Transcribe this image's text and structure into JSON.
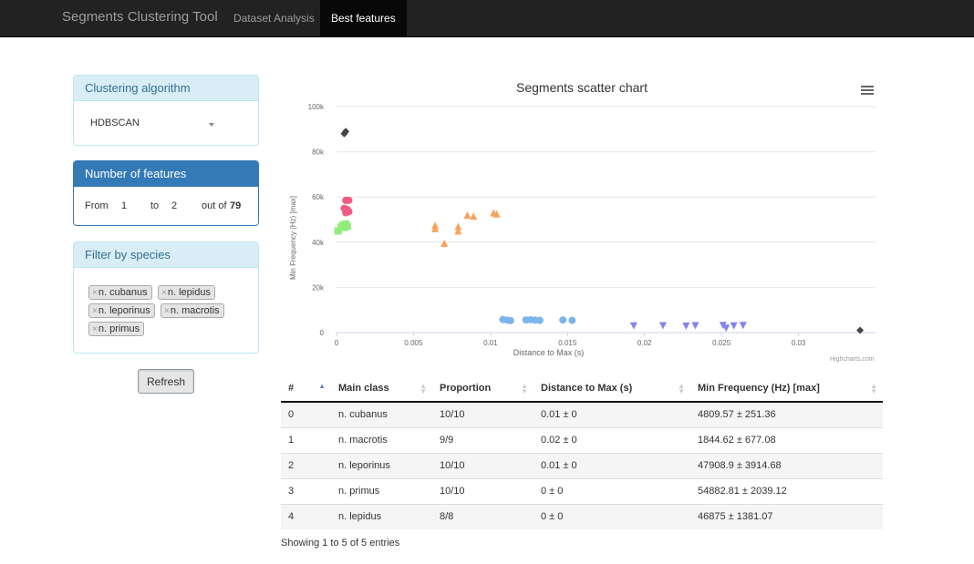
{
  "navbar": {
    "brand": "Segments Clustering Tool",
    "items": [
      {
        "label": "Dataset Analysis",
        "active": false
      },
      {
        "label": "Best features",
        "active": true
      }
    ]
  },
  "sidebar": {
    "clustering": {
      "heading": "Clustering algorithm",
      "selected": "HDBSCAN"
    },
    "features": {
      "heading": "Number of features",
      "from_label": "From",
      "from_value": "1",
      "to_label": "to",
      "to_value": "2",
      "outof_label": "out of",
      "outof_value": "79"
    },
    "species": {
      "heading": "Filter by species",
      "tags": [
        "n. cubanus",
        "n. lepidus",
        "n. leporinus",
        "n. macrotis",
        "n. primus"
      ],
      "remove_glyph": "×"
    },
    "refresh_label": "Refresh"
  },
  "chart_data": {
    "type": "scatter",
    "title": "Segments scatter chart",
    "xlabel": "Distance to Max (s)",
    "ylabel": "Min Frequency (Hz) [max]",
    "xlim": [
      0,
      0.035
    ],
    "ylim": [
      0,
      100000
    ],
    "x_ticks": [
      "0",
      "0.005",
      "0.01",
      "0.015",
      "0.02",
      "0.025",
      "0.03"
    ],
    "y_ticks": [
      "0",
      "20k",
      "40k",
      "60k",
      "80k",
      "100k"
    ],
    "credit": "Highcharts.com",
    "grid": true,
    "series": [
      {
        "color": "#434348",
        "marker": "diamond",
        "points": [
          [
            0.0005,
            88000
          ],
          [
            0.0006,
            89000
          ],
          [
            0.034,
            1000
          ]
        ]
      },
      {
        "color": "#f15c80",
        "marker": "circle",
        "points": [
          [
            0.0006,
            58500
          ],
          [
            0.0008,
            58500
          ],
          [
            0.0005,
            55000
          ],
          [
            0.0007,
            54500
          ],
          [
            0.0008,
            53500
          ],
          [
            0.0006,
            53000
          ]
        ]
      },
      {
        "color": "#90ed7d",
        "marker": "square",
        "points": [
          [
            0.0001,
            45000
          ],
          [
            0.0003,
            46500
          ],
          [
            0.0004,
            47500
          ],
          [
            0.0006,
            48000
          ],
          [
            0.0007,
            47000
          ],
          [
            0.0005,
            46500
          ]
        ]
      },
      {
        "color": "#f7a35c",
        "marker": "triangle",
        "points": [
          [
            0.0064,
            47500
          ],
          [
            0.0064,
            46000
          ],
          [
            0.007,
            39500
          ],
          [
            0.0079,
            47000
          ],
          [
            0.0079,
            45000
          ],
          [
            0.0085,
            52000
          ],
          [
            0.0089,
            51500
          ],
          [
            0.0102,
            53000
          ],
          [
            0.0104,
            52500
          ]
        ]
      },
      {
        "color": "#7cb5ec",
        "marker": "circle",
        "points": [
          [
            0.0108,
            5800
          ],
          [
            0.0111,
            5500
          ],
          [
            0.0113,
            5300
          ],
          [
            0.0123,
            5600
          ],
          [
            0.0126,
            5700
          ],
          [
            0.0129,
            5500
          ],
          [
            0.0132,
            5400
          ],
          [
            0.0147,
            5600
          ],
          [
            0.0153,
            5400
          ]
        ]
      },
      {
        "color": "#8085e9",
        "marker": "triangle-down",
        "points": [
          [
            0.0193,
            2900
          ],
          [
            0.0212,
            3000
          ],
          [
            0.0227,
            2800
          ],
          [
            0.0233,
            3000
          ],
          [
            0.0251,
            3100
          ],
          [
            0.0253,
            1900
          ],
          [
            0.0258,
            2900
          ],
          [
            0.0264,
            3100
          ]
        ]
      }
    ]
  },
  "table": {
    "columns": [
      "#",
      "Main class",
      "Proportion",
      "Distance to Max (s)",
      "Min Frequency (Hz) [max]"
    ],
    "rows": [
      [
        "0",
        "n. cubanus",
        "10/10",
        "0.01 ± 0",
        "4809.57 ± 251.36"
      ],
      [
        "1",
        "n. macrotis",
        "9/9",
        "0.02 ± 0",
        "1844.62 ± 677.08"
      ],
      [
        "2",
        "n. leporinus",
        "10/10",
        "0.01 ± 0",
        "47908.9 ± 3914.68"
      ],
      [
        "3",
        "n. primus",
        "10/10",
        "0 ± 0",
        "54882.81 ± 2039.12"
      ],
      [
        "4",
        "n. lepidus",
        "8/8",
        "0 ± 0",
        "46875 ± 1381.07"
      ]
    ],
    "info": "Showing 1 to 5 of 5 entries"
  }
}
